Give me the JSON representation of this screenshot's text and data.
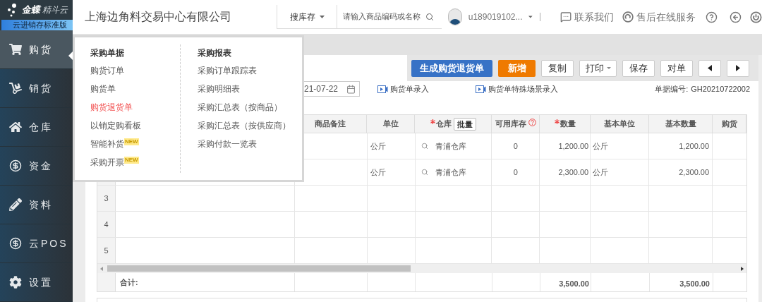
{
  "brand": {
    "name": "金蝶",
    "product": "精斗云",
    "edition": "云进销存标准版"
  },
  "sidebar": {
    "items": [
      {
        "label": "购货",
        "selected": true
      },
      {
        "label": "销货",
        "selected": false
      },
      {
        "label": "仓库",
        "selected": false
      },
      {
        "label": "资金",
        "selected": false
      },
      {
        "label": "资料",
        "selected": false
      },
      {
        "label": "云POS",
        "selected": false
      },
      {
        "label": "设置",
        "selected": false
      }
    ]
  },
  "header": {
    "company": "上海边角料交易中心有限公司",
    "search": {
      "scope": "搜库存",
      "placeholder": "请输入商品编码或名称"
    },
    "user": "u189019102...",
    "links": [
      "联系我们",
      "售后在线服务"
    ]
  },
  "menu": {
    "groups": [
      {
        "title": "采购单据",
        "items": [
          {
            "label": "购货订单",
            "selected": false
          },
          {
            "label": "购货单",
            "selected": false
          },
          {
            "label": "购货退货单",
            "selected": true
          },
          {
            "label": "以销定购看板",
            "selected": false
          },
          {
            "label": "智能补货",
            "selected": false,
            "badge": "NEW"
          },
          {
            "label": "采购开票",
            "selected": false,
            "badge": "NEW"
          }
        ]
      },
      {
        "title": "采购报表",
        "items": [
          {
            "label": "采购订单跟踪表",
            "selected": false
          },
          {
            "label": "采购明细表",
            "selected": false
          },
          {
            "label": "采购汇总表（按商品）",
            "selected": false
          },
          {
            "label": "采购汇总表（按供应商）",
            "selected": false
          },
          {
            "label": "采购付款一览表",
            "selected": false
          }
        ]
      }
    ]
  },
  "toolbar": [
    {
      "kind": "primary",
      "label": "生成购货退货单"
    },
    {
      "kind": "accent",
      "label": "新增"
    },
    {
      "kind": "default",
      "label": "复制"
    },
    {
      "kind": "dropdown",
      "label": "打印"
    },
    {
      "kind": "default",
      "label": "保存"
    },
    {
      "kind": "default",
      "label": "对单"
    },
    {
      "kind": "prev"
    },
    {
      "kind": "next"
    }
  ],
  "form": {
    "date": "21-07-22",
    "video_links": [
      "购货单录入",
      "购货单特殊场景录入"
    ],
    "doc_no_label": "单据编号:",
    "doc_no": "GH20210722002"
  },
  "table": {
    "columns": [
      {
        "label": "商品备注",
        "required": false
      },
      {
        "label": "单位",
        "required": false
      },
      {
        "label": "仓库",
        "required": true,
        "button": "批量"
      },
      {
        "label": "可用库存",
        "required": false,
        "help": true
      },
      {
        "label": "数量",
        "required": true
      },
      {
        "label": "基本单位",
        "required": false
      },
      {
        "label": "基本数量",
        "required": false
      },
      {
        "label": "购货",
        "required": false
      }
    ],
    "rows": [
      {
        "unit": "公斤",
        "warehouse": "青浦仓库",
        "available": "0",
        "qty": "1,200.00",
        "base_unit": "公斤",
        "base_qty": "1,200.00"
      },
      {
        "unit": "公斤",
        "warehouse": "青浦仓库",
        "available": "0",
        "qty": "2,300.00",
        "base_unit": "公斤",
        "base_qty": "2,300.00"
      },
      {
        "no": "3"
      },
      {
        "no": "4"
      },
      {
        "no": "5"
      }
    ],
    "totals": {
      "label": "合计:",
      "qty": "3,500.00",
      "base_qty": "3,500.00"
    }
  }
}
